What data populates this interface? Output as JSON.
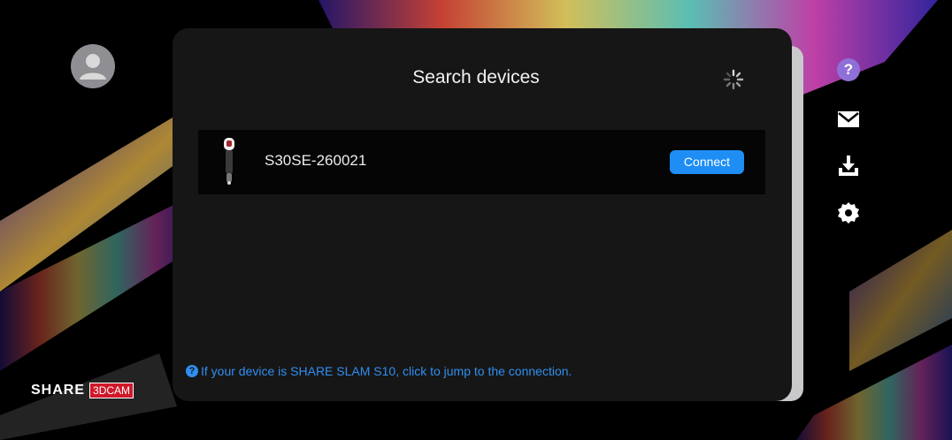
{
  "panel": {
    "title": "Search devices"
  },
  "devices": [
    {
      "name": "S30SE-260021",
      "connect_label": "Connect"
    }
  ],
  "hint": {
    "text": "If your device is SHARE SLAM S10, click to jump to the connection."
  },
  "sidebar": {
    "help_symbol": "?",
    "icons": [
      "help-icon",
      "mail-icon",
      "download-icon",
      "settings-icon"
    ]
  },
  "brand": {
    "share": "SHARE",
    "badge": "3DCAM"
  },
  "colors": {
    "accent": "#1e8ef5",
    "help": "#8f6fd8",
    "brand_red": "#d0182a"
  }
}
